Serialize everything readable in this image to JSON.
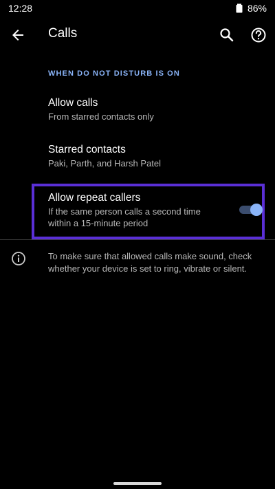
{
  "status_bar": {
    "time": "12:28",
    "battery": "86%",
    "battery_icon": "battery-icon"
  },
  "app_bar": {
    "title": "Calls",
    "back_icon": "arrow-back-icon",
    "search_icon": "search-icon",
    "help_icon": "help-icon"
  },
  "section": {
    "header": "WHEN DO NOT DISTURB IS ON"
  },
  "items": [
    {
      "title": "Allow calls",
      "summary": [
        "From starred contacts only"
      ]
    },
    {
      "title": "Starred contacts",
      "summary": [
        "Paki, Parth, and Harsh Patel"
      ]
    },
    {
      "title": "Allow repeat callers",
      "summary": [
        "If the same person calls a second time",
        "within a 15-minute period"
      ],
      "toggle_on": true
    }
  ],
  "info": {
    "icon": "info-icon",
    "lines": [
      "To make sure that allowed calls make sound, check",
      "whether your device is set to ring, vibrate or silent."
    ]
  },
  "colors": {
    "background": "#000000",
    "accent": "#8ab4f8",
    "highlight_border": "#5a2fd6",
    "secondary_text": "#b8b8b8"
  }
}
